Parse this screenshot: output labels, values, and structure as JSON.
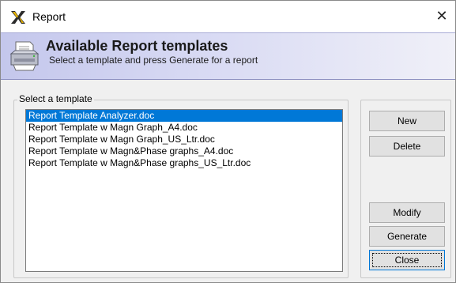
{
  "window": {
    "title": "Report",
    "close_glyph": "✕",
    "app_icon": "x-logo-icon"
  },
  "header": {
    "title": "Available Report templates",
    "subtitle": "Select a template and press Generate for a report",
    "icon": "printer-icon",
    "gradient_start": "#c4c7ec",
    "gradient_end": "#f0f0f8"
  },
  "template_group": {
    "legend": "Select a template",
    "selected_index": 0,
    "items": [
      "Report Template Analyzer.doc",
      "Report Template w Magn Graph_A4.doc",
      "Report Template w Magn Graph_US_Ltr.doc",
      "Report Template w Magn&Phase graphs_A4.doc",
      "Report Template w Magn&Phase graphs_US_Ltr.doc"
    ]
  },
  "buttons": {
    "new": "New",
    "delete": "Delete",
    "modify": "Modify",
    "generate": "Generate",
    "close": "Close"
  },
  "colors": {
    "selection": "#0078d7",
    "dialog_bg": "#f0f0f0"
  }
}
